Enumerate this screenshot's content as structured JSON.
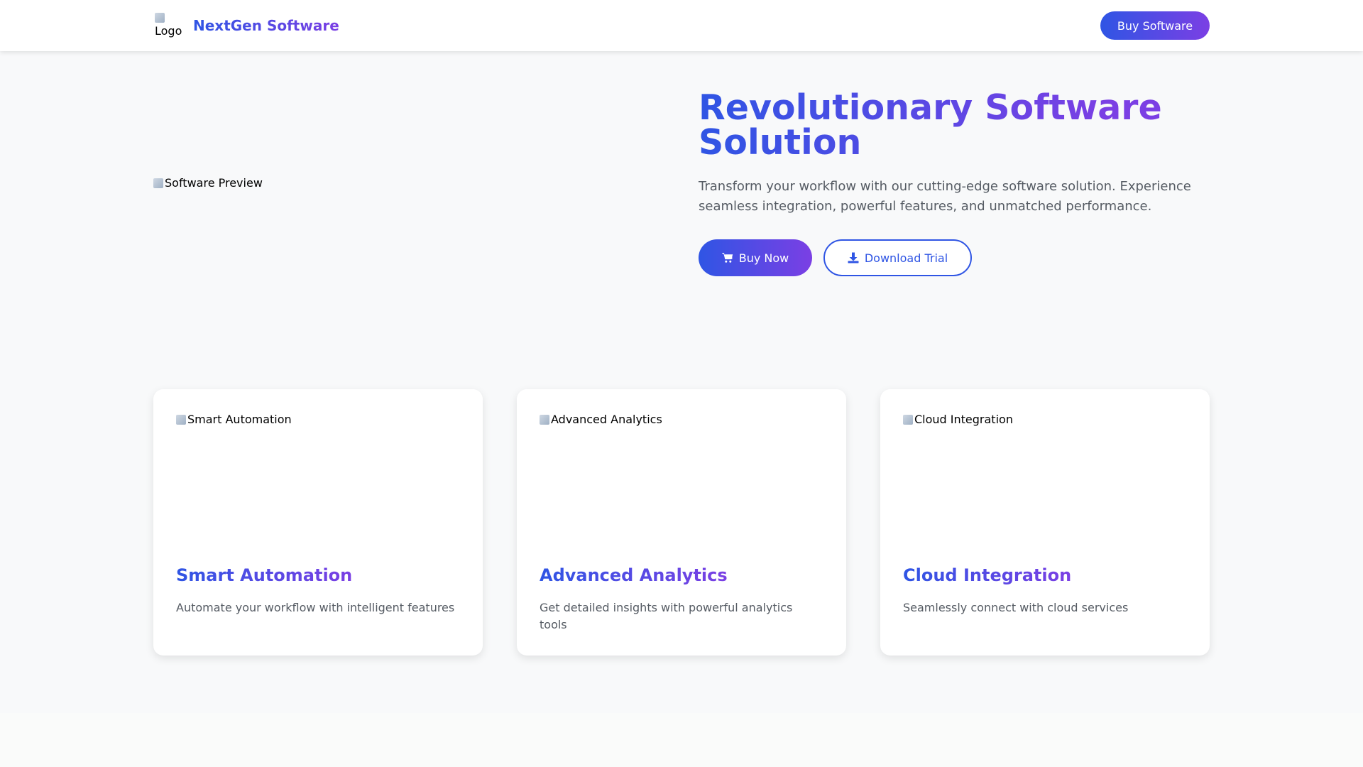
{
  "header": {
    "logo_alt": "Logo",
    "brand": "NextGen Software",
    "buy_button": "Buy Software"
  },
  "hero": {
    "image_alt": "Software Preview",
    "title_line1": "Revolutionary Software",
    "title_line2": "Solution",
    "subtitle": "Transform your workflow with our cutting-edge software solution. Experience seamless integration, powerful features, and unmatched performance.",
    "buy_now": "Buy Now",
    "download_trial": "Download Trial"
  },
  "features": [
    {
      "image_alt": "Smart Automation",
      "title": "Smart Automation",
      "description": "Automate your workflow with intelligent features"
    },
    {
      "image_alt": "Advanced Analytics",
      "title": "Advanced Analytics",
      "description": "Get detailed insights with powerful analytics tools"
    },
    {
      "image_alt": "Cloud Integration",
      "title": "Cloud Integration",
      "description": "Seamlessly connect with cloud services"
    }
  ],
  "icons": {
    "cart": "shopping-cart-icon",
    "download": "download-icon",
    "broken_image": "broken-image-icon"
  },
  "colors": {
    "gradient_start": "#2f55e4",
    "gradient_end": "#7b3fe4",
    "background": "#f8f9fa",
    "text_muted": "#555b63"
  }
}
